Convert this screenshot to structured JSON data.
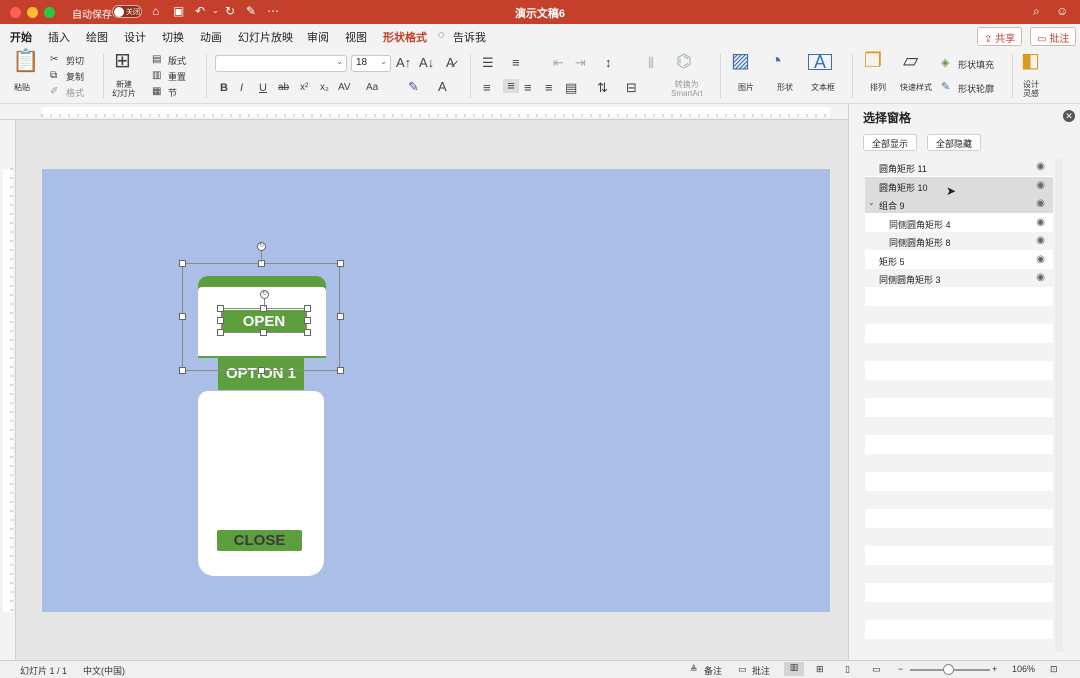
{
  "window": {
    "title": "演示文稿6",
    "autosave_label": "自动保存",
    "autosave_state": "关闭"
  },
  "tabs": [
    "开始",
    "插入",
    "绘图",
    "设计",
    "切换",
    "动画",
    "幻灯片放映",
    "审阅",
    "视图",
    "形状格式",
    "告诉我"
  ],
  "top_buttons": {
    "share": "共享",
    "comment": "批注"
  },
  "ribbon": {
    "paste": "粘贴",
    "cut": "剪切",
    "copy": "复制",
    "format_painter": "格式",
    "new_slide": "新建\n幻灯片",
    "layout": "版式",
    "reset": "重置",
    "section": "节",
    "font_name": "",
    "font_size": "18",
    "convert_smartart": "转换为\nSmartArt",
    "picture": "图片",
    "shape": "形状",
    "textbox": "文本框",
    "arrange": "排列",
    "quick_styles": "快速样式",
    "shape_fill": "形状填充",
    "shape_outline": "形状轮廓",
    "designer": "设计\n灵感"
  },
  "slide": {
    "open_label": "OPEN",
    "option_label": "OPTION 1",
    "close_label": "CLOSE"
  },
  "selection_pane": {
    "title": "选择窗格",
    "show_all": "全部显示",
    "hide_all": "全部隐藏",
    "items": [
      {
        "label": "圆角矩形 11",
        "indent": 0,
        "selected": false
      },
      {
        "label": "圆角矩形 10",
        "indent": 0,
        "selected": true
      },
      {
        "label": "组合 9",
        "indent": 0,
        "selected": true,
        "group": true
      },
      {
        "label": "同侧圆角矩形 4",
        "indent": 1,
        "selected": false
      },
      {
        "label": "同侧圆角矩形 8",
        "indent": 1,
        "selected": false
      },
      {
        "label": "矩形 5",
        "indent": 0,
        "selected": false
      },
      {
        "label": "同侧圆角矩形 3",
        "indent": 0,
        "selected": false
      }
    ]
  },
  "status": {
    "slide_count": "幻灯片 1 / 1",
    "language": "中文(中国)",
    "notes": "备注",
    "comments": "批注",
    "zoom": "106%"
  },
  "colors": {
    "titlebar": "#c4402a",
    "slide_bg": "#abbfe6",
    "accent_green": "#5e9f3d"
  }
}
